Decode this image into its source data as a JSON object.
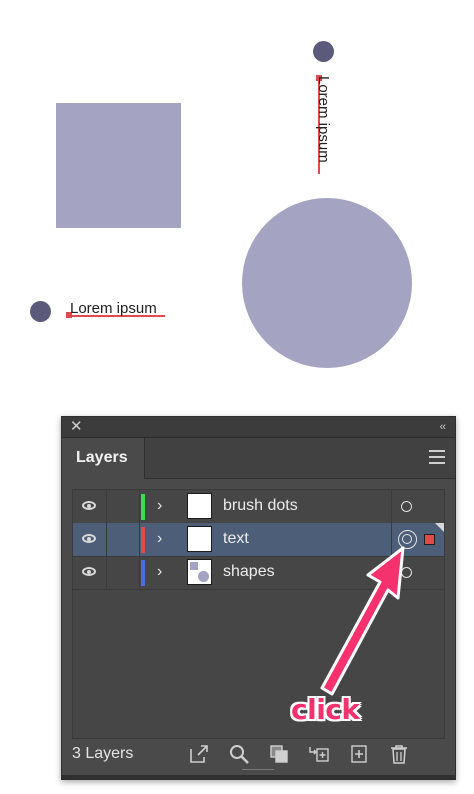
{
  "artboard": {
    "text_horizontal": "Lorem ipsum",
    "text_vertical": "Lorem ipsum",
    "shape_color": "#a4a3c1",
    "dot_color": "#5b5a7a",
    "selection_color": "#e04a4a"
  },
  "panel": {
    "close_icon": "close-icon",
    "collapse_glyph": "‹‹",
    "tab_label": "Layers",
    "layers": [
      {
        "name": "brush dots",
        "color": "#3ddc4a",
        "selected": false
      },
      {
        "name": "text",
        "color": "#e04a4a",
        "selected": true
      },
      {
        "name": "shapes",
        "color": "#4a6ee0",
        "selected": false
      }
    ],
    "footer": {
      "count_label": "3 Layers",
      "icons": [
        "export-icon",
        "search-icon",
        "clipping-mask-icon",
        "new-sublayer-icon",
        "new-layer-icon",
        "trash-icon"
      ]
    }
  },
  "annotation": {
    "label": "click",
    "color": "#f5326e"
  }
}
